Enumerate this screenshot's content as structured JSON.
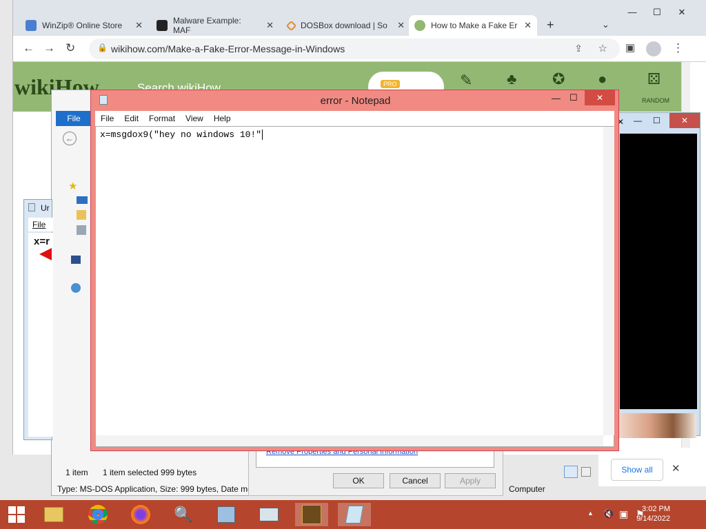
{
  "browser": {
    "tabs": [
      {
        "title": "WinZip® Online Store",
        "close": "✕"
      },
      {
        "title": "Malware Example: MAF",
        "close": "✕"
      },
      {
        "title": "DOSBox download | So",
        "close": "✕"
      },
      {
        "title": "How to Make a Fake Er",
        "close": "✕"
      }
    ],
    "new_tab": "+",
    "url": "wikihow.com/Make-a-Fake-Error-Message-in-Windows"
  },
  "wikihow": {
    "logo": "wikiHow",
    "search_placeholder": "Search wikiHow",
    "pro_badge": "PRO",
    "random_label": "RANDOM"
  },
  "explorer": {
    "file_tab": "File",
    "status_items": "1 item",
    "status_selected": "1 item selected  999 bytes",
    "type_line": "Type: MS-DOS Application, Size: 999 bytes, Date mo",
    "computer_label": "Computer",
    "show_all": "Show all"
  },
  "props_dialog": {
    "link": "Remove Properties and Personal Information",
    "ok": "OK",
    "cancel": "Cancel",
    "apply": "Apply"
  },
  "small_notepad": {
    "title": "Ur",
    "menu_file": "File",
    "text": "x=r"
  },
  "notepad": {
    "title": "error - Notepad",
    "menu": [
      "File",
      "Edit",
      "Format",
      "View",
      "Help"
    ],
    "content": "x=msgdox9(\"hey no windows 10!\""
  },
  "taskbar": {
    "time": "3:02 PM",
    "date": "9/14/2022"
  },
  "colors": {
    "notepad_frame": "#f08a82",
    "taskbar": "#b5452c",
    "wikihow_green": "#93b874"
  }
}
